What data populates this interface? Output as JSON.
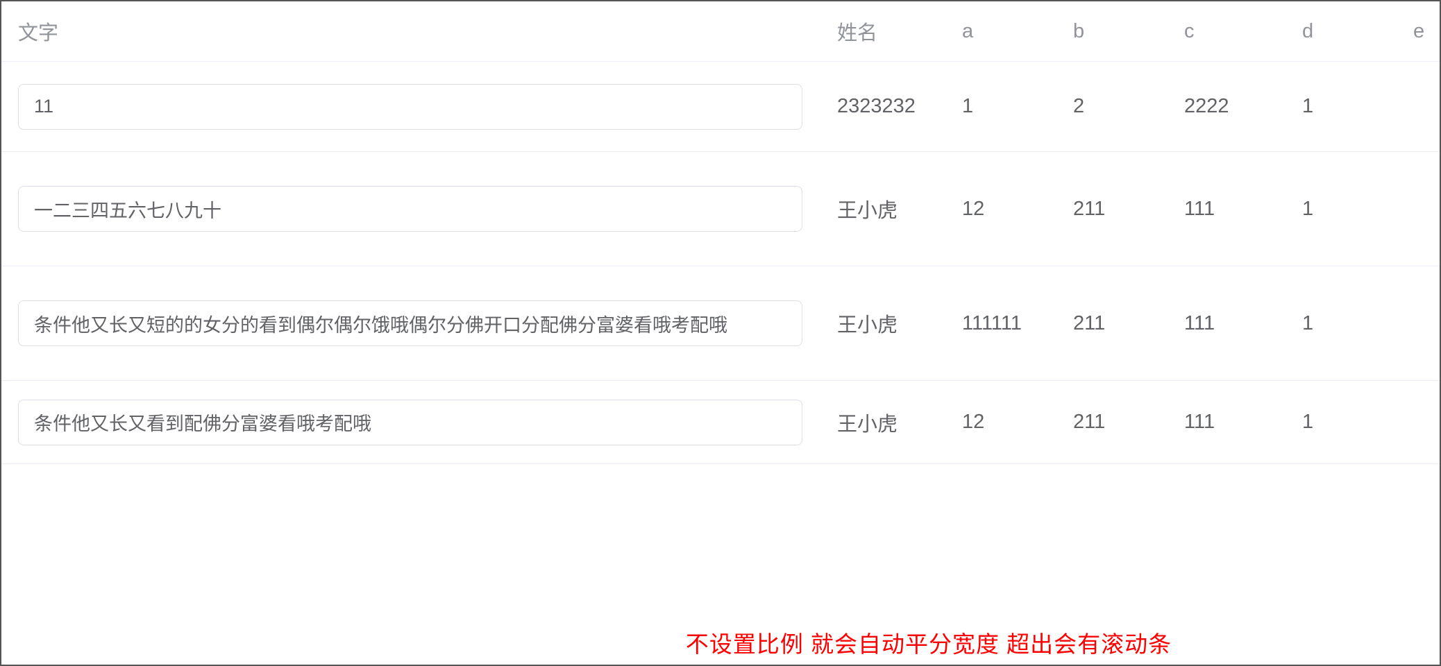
{
  "table": {
    "headers": {
      "text": "文字",
      "name": "姓名",
      "a": "a",
      "b": "b",
      "c": "c",
      "d": "d",
      "e": "e"
    },
    "rows": [
      {
        "text": "11",
        "name": "2323232",
        "a": "1",
        "b": "2",
        "c": "2222",
        "d": "1",
        "e": ""
      },
      {
        "text": "一二三四五六七八九十",
        "name": "王小虎",
        "a": "12",
        "b": "211",
        "c": "111",
        "d": "1",
        "e": ""
      },
      {
        "text": "条件他又长又短的的女分的看到偶尔偶尔饿哦偶尔分佛开口分配佛分富婆看哦考配哦",
        "name": "王小虎",
        "a": "111111",
        "b": "211",
        "c": "111",
        "d": "1",
        "e": ""
      },
      {
        "text": "条件他又长又看到配佛分富婆看哦考配哦",
        "name": "王小虎",
        "a": "12",
        "b": "211",
        "c": "111",
        "d": "1",
        "e": ""
      }
    ]
  },
  "footer_note": "不设置比例  就会自动平分宽度  超出会有滚动条"
}
